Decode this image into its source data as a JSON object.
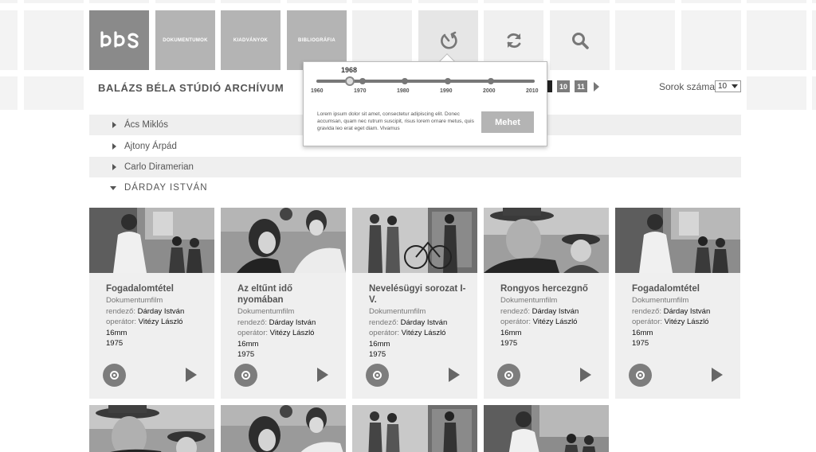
{
  "nav": {
    "tabs": [
      {
        "label": "DOKUMENTUMOK"
      },
      {
        "label": "KIADVÁNYOK"
      },
      {
        "label": "BIBLIOGRÁFIA"
      }
    ],
    "logo_icon": "bbs-logo",
    "icons": [
      "timeline-icon",
      "refresh-icon",
      "search-icon"
    ]
  },
  "header": {
    "title": "BALÁZS BÉLA STÚDIÓ ARCHÍVUM"
  },
  "pagination": {
    "pages": [
      "10",
      "11"
    ]
  },
  "rows": {
    "label": "Sorok száma",
    "value": "10"
  },
  "timeline": {
    "selected_year": "1968",
    "years": [
      "1960",
      "1970",
      "1980",
      "1990",
      "2000",
      "2010"
    ],
    "description": "Lorem ipsum dolor sit amet, consectetur adipiscing elit. Donec accumsan, quam nec rutrum suscipit, risus lorem ornare metus, quis gravida leo erat eget diam. Vivamus",
    "button": "Mehet"
  },
  "directors": [
    {
      "name": "Ács Miklós"
    },
    {
      "name": "Ajtony Árpád"
    },
    {
      "name": "Carlo Diramerian"
    },
    {
      "name": "DÁRDAY ISTVÁN"
    }
  ],
  "films": [
    {
      "title": "Fogadalomtétel",
      "type": "Dokumentumfilm",
      "director_label": "rendező:",
      "director": "Dárday István",
      "operator_label": "operátor:",
      "operator": "Vitézy László",
      "format": "16mm",
      "year": "1975"
    },
    {
      "title": "Az eltűnt idő nyomában",
      "type": "Dokumentumfilm",
      "director_label": "rendező:",
      "director": "Dárday István",
      "operator_label": "operátor:",
      "operator": "Vitézy László",
      "format": "16mm",
      "year": "1975"
    },
    {
      "title": "Nevelésügyi sorozat I-V.",
      "type": "Dokumentumfilm",
      "director_label": "rendező:",
      "director": "Dárday István",
      "operator_label": "operátor:",
      "operator": "Vitézy László",
      "format": "16mm",
      "year": "1975"
    },
    {
      "title": "Rongyos hercezgnő",
      "type": "Dokumentumfilm",
      "director_label": "rendező:",
      "director": "Dárday István",
      "operator_label": "operátor:",
      "operator": "Vitézy László",
      "format": "16mm",
      "year": "1975"
    },
    {
      "title": "Fogadalomtétel",
      "type": "Dokumentumfilm",
      "director_label": "rendező:",
      "director": "Dárday István",
      "operator_label": "operátor:",
      "operator": "Vitézy László",
      "format": "16mm",
      "year": "1975"
    }
  ]
}
